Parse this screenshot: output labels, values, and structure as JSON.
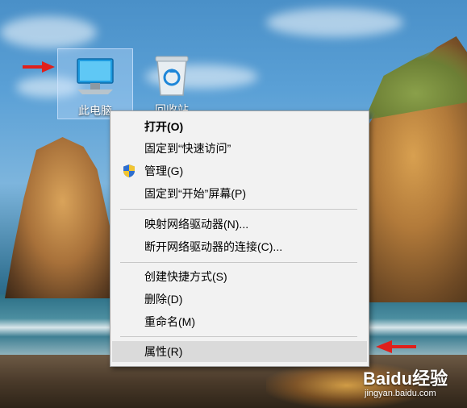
{
  "desktop": {
    "icons": [
      {
        "label": "此电脑",
        "icon": "this-pc-icon",
        "selected": true
      },
      {
        "label": "回收站",
        "icon": "recycle-bin-icon",
        "selected": false
      }
    ]
  },
  "context_menu": {
    "groups": [
      [
        {
          "label": "打开(O)",
          "bold": true
        },
        {
          "label": "固定到“快速访问”"
        },
        {
          "label": "管理(G)",
          "icon": "uac-shield-icon"
        },
        {
          "label": "固定到“开始”屏幕(P)"
        }
      ],
      [
        {
          "label": "映射网络驱动器(N)..."
        },
        {
          "label": "断开网络驱动器的连接(C)..."
        }
      ],
      [
        {
          "label": "创建快捷方式(S)"
        },
        {
          "label": "删除(D)"
        },
        {
          "label": "重命名(M)"
        }
      ],
      [
        {
          "label": "属性(R)",
          "highlighted": true
        }
      ]
    ]
  },
  "watermark": {
    "main": "Baidu经验",
    "sub": "jingyan.baidu.com"
  },
  "colors": {
    "annotation_arrow": "#e0201c",
    "menu_background": "#f2f2f2",
    "menu_hover": "#dadada"
  }
}
